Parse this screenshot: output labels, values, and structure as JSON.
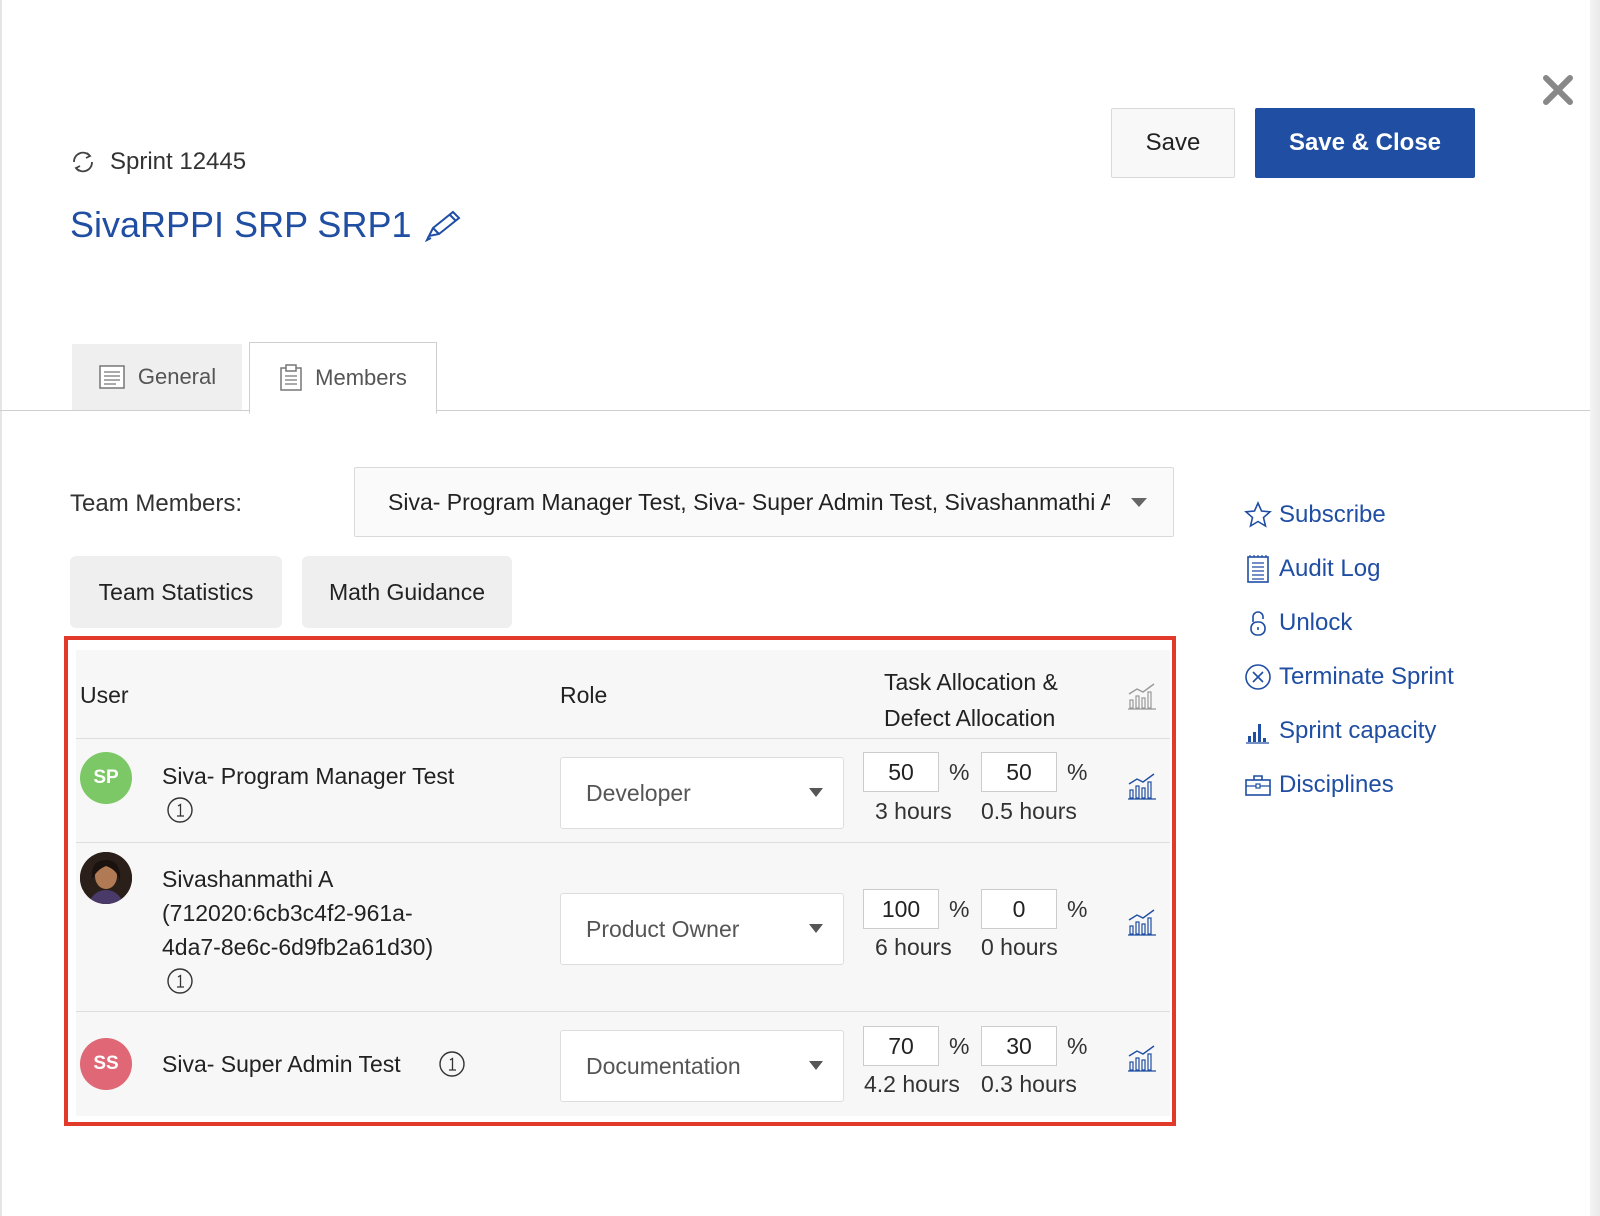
{
  "header": {
    "sprint_label": "Sprint 12445",
    "title": "SivaRPPI SRP SRP1",
    "save_label": "Save",
    "save_close_label": "Save & Close"
  },
  "tabs": [
    {
      "label": "General",
      "icon": "document-icon"
    },
    {
      "label": "Members",
      "icon": "clipboard-icon"
    }
  ],
  "team": {
    "label": "Team Members:",
    "selected": "Siva- Program Manager Test, Siva- Super Admin Test, Sivashanmathi A"
  },
  "buttons": {
    "team_statistics": "Team Statistics",
    "math_guidance": "Math Guidance"
  },
  "side_links": [
    {
      "label": "Subscribe",
      "icon": "star-icon"
    },
    {
      "label": "Audit Log",
      "icon": "notepad-icon"
    },
    {
      "label": "Unlock",
      "icon": "lock-icon"
    },
    {
      "label": "Terminate Sprint",
      "icon": "circle-x-icon"
    },
    {
      "label": "Sprint capacity",
      "icon": "bar-chart-icon"
    },
    {
      "label": "Disciplines",
      "icon": "briefcase-icon"
    }
  ],
  "table": {
    "headers": {
      "user": "User",
      "role": "Role",
      "allocation_line1": "Task Allocation &",
      "allocation_line2": "Defect Allocation"
    },
    "rows": [
      {
        "initials": "SP",
        "avatar_color": "#7cc867",
        "name_lines": [
          "Siva- Program Manager Test"
        ],
        "info": "1",
        "role": "Developer",
        "task_pct": "50",
        "defect_pct": "50",
        "task_hours": "3 hours",
        "defect_hours": "0.5 hours"
      },
      {
        "initials": "",
        "avatar_color": "#3a2a22",
        "name_lines": [
          "Sivashanmathi A",
          "(712020:6cb3c4f2-961a-",
          "4da7-8e6c-6d9fb2a61d30)"
        ],
        "info": "1",
        "role": "Product Owner",
        "task_pct": "100",
        "defect_pct": "0",
        "task_hours": "6 hours",
        "defect_hours": "0 hours"
      },
      {
        "initials": "SS",
        "avatar_color": "#e06876",
        "name_lines": [
          "Siva- Super Admin Test"
        ],
        "info": "1",
        "role": "Documentation",
        "task_pct": "70",
        "defect_pct": "30",
        "task_hours": "4.2 hours",
        "defect_hours": "0.3 hours"
      }
    ],
    "percent_sign": "%"
  },
  "colors": {
    "brand": "#1f4ea3",
    "highlight": "#e23a2a"
  }
}
